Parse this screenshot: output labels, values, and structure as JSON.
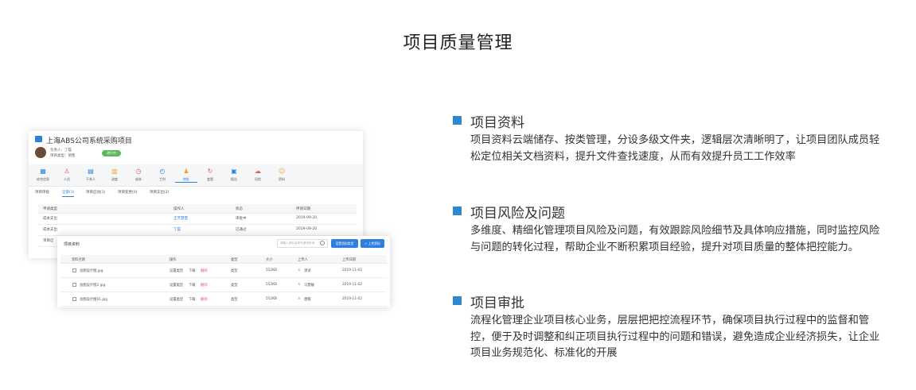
{
  "page_title": "项目质量管理",
  "screenshot": {
    "project_name": "上海ABS公司系统采购项目",
    "manager_line": "负责人：丁磊",
    "type_line": "项目类型：销售",
    "status_badge": "进行中",
    "nav_items": [
      {
        "label": "综合信息",
        "icon": "grid-icon",
        "glyph": "▦",
        "color": "#2d7fe0"
      },
      {
        "label": "人员",
        "icon": "person-icon",
        "glyph": "♙",
        "color": "#e55"
      },
      {
        "label": "干系人",
        "icon": "contacts-icon",
        "glyph": "▤",
        "color": "#2d7fe0"
      },
      {
        "label": "进度",
        "icon": "progress-icon",
        "glyph": "▥",
        "color": "#f0a030"
      },
      {
        "label": "成本",
        "icon": "clock-icon",
        "glyph": "◷",
        "color": "#e55"
      },
      {
        "label": "工时",
        "icon": "timer-icon",
        "glyph": "◴",
        "color": "#2d7fe0"
      },
      {
        "label": "审批",
        "icon": "approval-icon",
        "glyph": "♟",
        "color": "#f0a030"
      },
      {
        "label": "变更",
        "icon": "change-icon",
        "glyph": "↻",
        "color": "#e55"
      },
      {
        "label": "报告",
        "icon": "report-icon",
        "glyph": "▣",
        "color": "#2d7fe0"
      },
      {
        "label": "风险",
        "icon": "cloud-icon",
        "glyph": "☁",
        "color": "#e55"
      },
      {
        "label": "资料",
        "icon": "folder-icon",
        "glyph": "☺",
        "color": "#f0a030"
      }
    ],
    "tabs": [
      "项目审批",
      "全部(1)",
      "项目启动(1)",
      "项目变更(0)",
      "项目支出(2)"
    ],
    "approval_table": {
      "headers": [
        "申请类型",
        "操作人",
        "状态",
        "申请日期"
      ],
      "rows": [
        [
          "成本支出",
          "王芳慧慧",
          "审批中",
          "2019-09-20"
        ],
        [
          "成本支出",
          "丁磊",
          "已通过",
          "2019-09-20"
        ],
        [
          "项目启",
          "",
          "",
          ""
        ]
      ]
    },
    "files_panel": {
      "title": "项目资料",
      "search_placeholder": "请输入资料名称关键词查询",
      "btn_settings": "设置资料类型",
      "btn_upload": "+ 上传资料",
      "headers": [
        "资料名称",
        "操作",
        "类型",
        "大小",
        "上传人",
        "上传日期"
      ],
      "rows": [
        {
          "name": "总图设计图.jpg",
          "set": "设置类型",
          "download": "下载",
          "delete": "删除",
          "type": "类型",
          "size": "552KB",
          "uploader": "测试",
          "date": "2019-11-02"
        },
        {
          "name": "总图设计图2.jpg",
          "set": "设置类型",
          "download": "下载",
          "delete": "删除",
          "type": "类型",
          "size": "552KB",
          "uploader": "马慧敏",
          "date": "2019-11-02"
        },
        {
          "name": "总图设计图01.jpg",
          "set": "设置类型",
          "download": "下载",
          "delete": "删除",
          "type": "类型",
          "size": "552KB",
          "uploader": "唐帽",
          "date": "2019-11-02"
        }
      ]
    }
  },
  "features": [
    {
      "title": "项目资料",
      "desc": "项目资料云端储存、按类管理，分设多级文件夹，逻辑层次清晰明了，让项目团队成员轻松定位相关文档资料，提升文件查找速度，从而有效提升员工工作效率"
    },
    {
      "title": "项目风险及问题",
      "desc": "多维度、精细化管理项目风险及问题，有效跟踪风险细节及具体响应措施，同时监控风险与问题的转化过程，帮助企业不断积累项目经验，提升对项目质量的整体把控能力。"
    },
    {
      "title": "项目审批",
      "desc": "流程化管理企业项目核心业务，层层把把控流程环节，确保项目执行过程中的监督和管控，便于及时调整和纠正项目执行过程中的问题和错误，避免造成企业经济损失，让企业项目业务规范化、标准化的开展"
    }
  ],
  "colors": {
    "accent": "#2e88cf",
    "link": "#2d7fe0",
    "status_green": "#5cb85c",
    "danger": "#e55555"
  }
}
